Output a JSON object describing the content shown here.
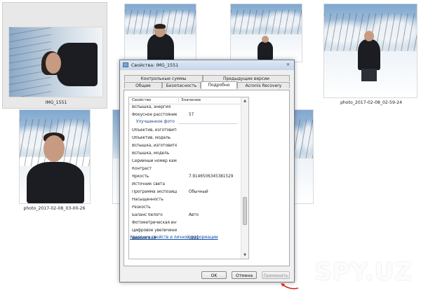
{
  "files": [
    {
      "name": "IMG_1551",
      "selected": true
    },
    {
      "name": "photo_2017-02-08_02-59-24"
    },
    {
      "name": "photo_2017-02-08_03-00-26"
    }
  ],
  "dialog": {
    "title": "Свойства: IMG_1551",
    "close_glyph": "×",
    "tabs_back": [
      "Контрольные суммы",
      "Предыдущие версии"
    ],
    "tabs_front": [
      "Общие",
      "Безопасность",
      "Подробно",
      "Acronis Recovery"
    ],
    "active_tab": "Подробно",
    "columns": {
      "property": "Свойство",
      "value": "Значение"
    },
    "rows": [
      {
        "p": "Вспышка, энергия",
        "v": ""
      },
      {
        "p": "Фокусное расстояние, э...",
        "v": "57"
      },
      {
        "group": "Улучшенное фото"
      },
      {
        "p": "Объектив, изготовитель",
        "v": ""
      },
      {
        "p": "Объектив, модель",
        "v": ""
      },
      {
        "p": "Вспышка, изготовитель",
        "v": ""
      },
      {
        "p": "Вспышка, модель",
        "v": ""
      },
      {
        "p": "Серийный номер камеры",
        "v": ""
      },
      {
        "p": "Контраст",
        "v": ""
      },
      {
        "p": "Яркость",
        "v": "7.9146506345381529"
      },
      {
        "p": "Источник света",
        "v": ""
      },
      {
        "p": "Программа экспозиции",
        "v": "Обычный"
      },
      {
        "p": "Насыщенность",
        "v": ""
      },
      {
        "p": "Резкость",
        "v": ""
      },
      {
        "p": "Баланс белого",
        "v": "Авто"
      },
      {
        "p": "Фотометрическая интер...",
        "v": ""
      },
      {
        "p": "Цифровое увеличение",
        "v": ""
      },
      {
        "p": "Версия EXIF",
        "v": "0221"
      }
    ],
    "remove_link": "Удаление свойств и личной информации",
    "buttons": {
      "ok": "OK",
      "cancel": "Отмена",
      "apply": "Применить"
    }
  },
  "watermark": "SPY.UZ",
  "colors": {
    "link": "#0a4aa8",
    "arrow": "#d8261e",
    "group": "#1e3f8a"
  }
}
